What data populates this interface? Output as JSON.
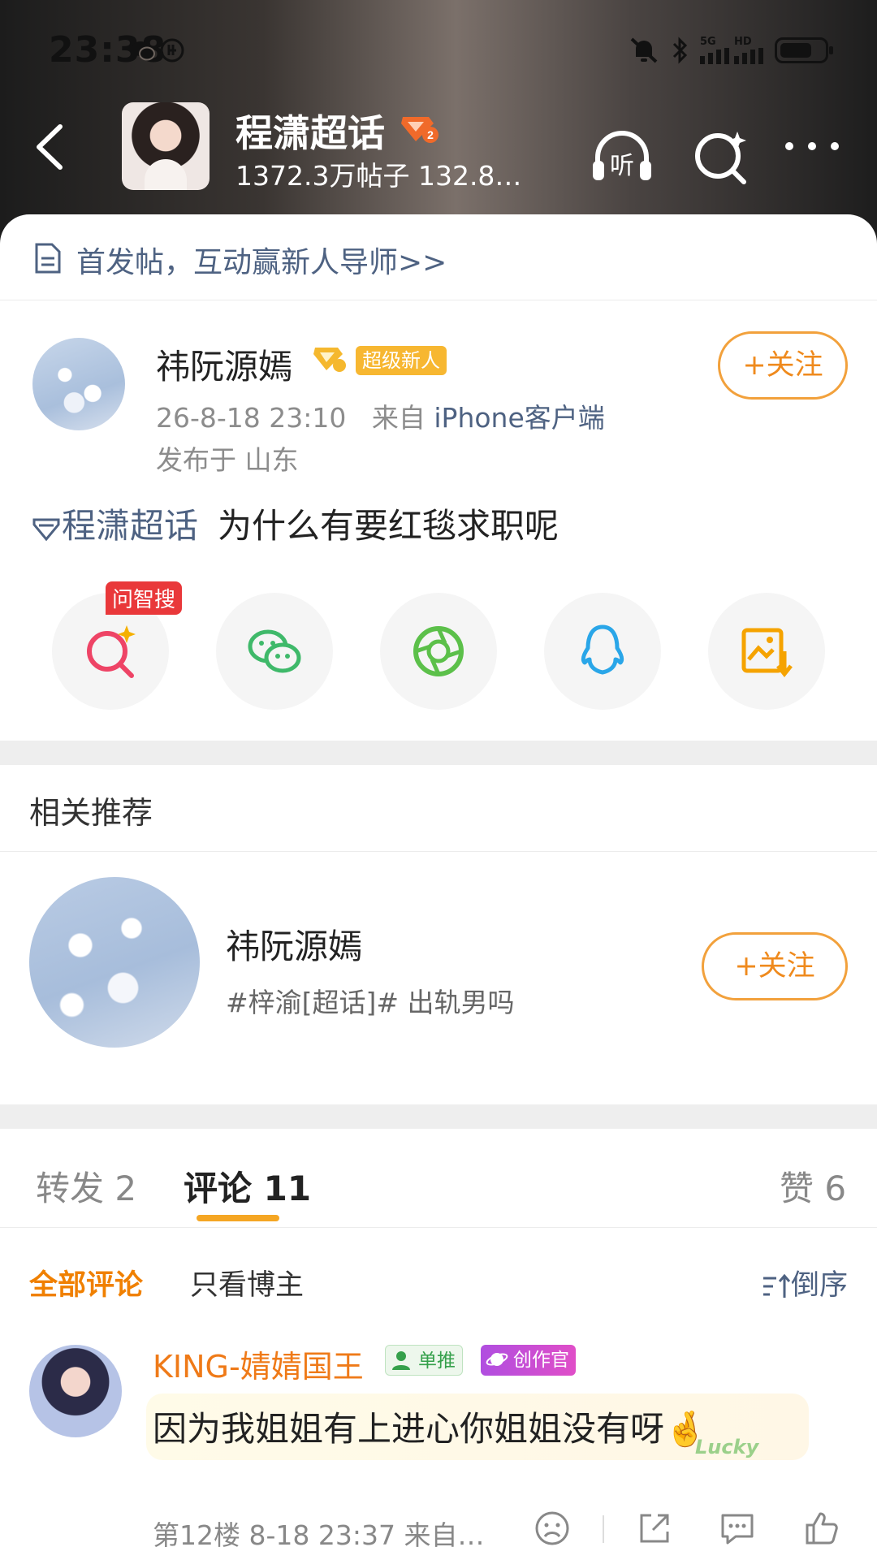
{
  "status_bar": {
    "time": "23:38",
    "network": "5G",
    "network_sub": "HD"
  },
  "header": {
    "title": "程潇超话",
    "stats": "1372.3万帖子 132.8…",
    "icons": [
      "back-icon",
      "listen-icon",
      "search-icon",
      "more-icon"
    ],
    "listen_label": "听"
  },
  "notice": {
    "text": "首发帖，互动赢新人导师>>"
  },
  "post": {
    "author": "祎阮源嫣",
    "author_badge": "超级新人",
    "follow_label": "+关注",
    "time": "26-8-18 23:10",
    "source_prefix": "来自",
    "source": "iPhone客户端",
    "location": "发布于 山东",
    "topic_tag": "程潇超话",
    "text": "为什么有要红毯求职呢"
  },
  "share": {
    "ai_tag": "问智搜",
    "items": [
      "ai-search-icon",
      "wechat-icon",
      "moments-icon",
      "qq-icon",
      "save-image-icon"
    ]
  },
  "recommend": {
    "title": "相关推荐",
    "name": "祎阮源嫣",
    "desc": "#梓渝[超话]#  出轨男吗",
    "follow_label": "+关注"
  },
  "tabs": {
    "repost": "转发 2",
    "comment": "评论 11",
    "like": "赞 6"
  },
  "filters": {
    "all": "全部评论",
    "blogger": "只看博主",
    "sort": "倒序"
  },
  "comment": {
    "name": "KING-婧婧国王",
    "chip_fan": "单推",
    "chip_creator": "创作官",
    "text": "因为我姐姐有上进心你姐姐没有呀🤞",
    "decor": "Lucky",
    "meta": "第12楼  8-18 23:37  来自…"
  },
  "colors": {
    "accent": "#f08000",
    "link": "#4e6282",
    "tab_underline": "#f5a623",
    "tag_red": "#e9383a"
  }
}
